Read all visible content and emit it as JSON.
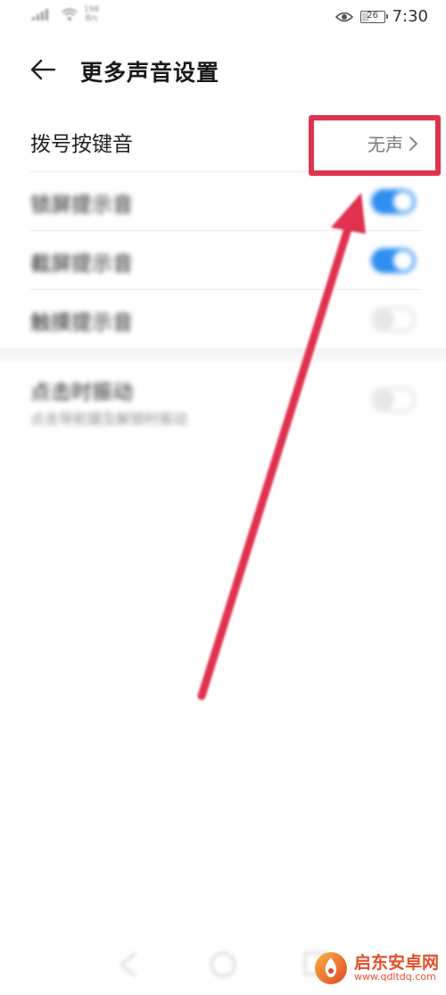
{
  "status_bar": {
    "net_speed_value": "198",
    "net_speed_unit": "B/s",
    "battery_level": "26",
    "time": "7:30"
  },
  "header": {
    "title": "更多声音设置",
    "back_icon": "arrow-left-icon"
  },
  "settings": {
    "dial_pad_tone": {
      "label": "拨号按键音",
      "value": "无声"
    },
    "row2": {
      "label": "锁屏提示音",
      "toggle": "on"
    },
    "row3": {
      "label": "截屏提示音",
      "toggle": "on"
    },
    "row4": {
      "label": "触摸提示音",
      "toggle": "off"
    },
    "row5": {
      "label": "点击时振动",
      "sublabel": "点击导航键及解锁时振动",
      "toggle": "off"
    }
  },
  "annotation": {
    "color": "#e0334f"
  },
  "watermark": {
    "name": "启东安卓网",
    "url": "www.qdltdq.com"
  },
  "colors": {
    "accent": "#2f8ff0",
    "annotation": "#e0334f",
    "watermark": "#e0502a"
  }
}
